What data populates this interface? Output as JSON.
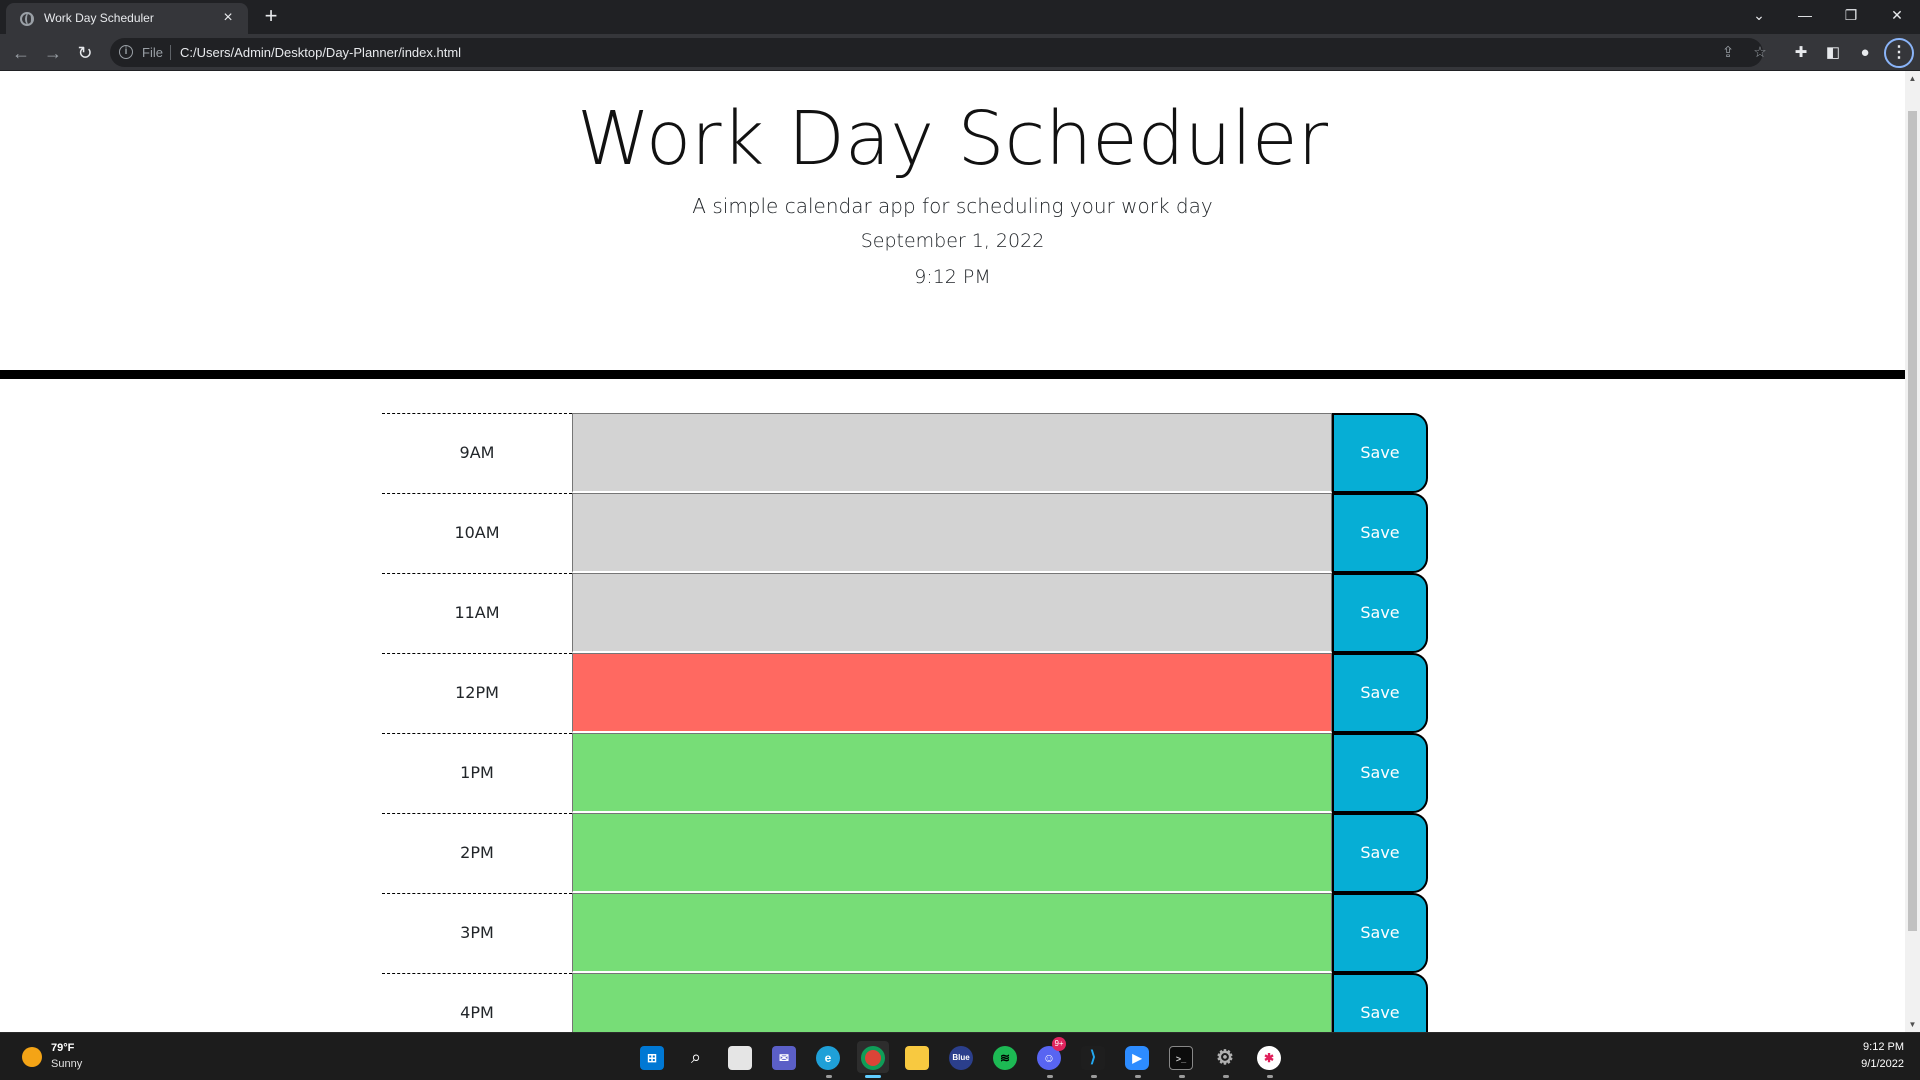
{
  "browser": {
    "tab_title": "Work Day Scheduler",
    "tab_close": "×",
    "new_tab": "+",
    "url_scheme_label": "File",
    "url": "C:/Users/Admin/Desktop/Day-Planner/index.html",
    "menu_glyph": "⋮"
  },
  "page": {
    "title": "Work Day Scheduler",
    "subtitle": "A simple calendar app for scheduling your work day",
    "current_date": "September 1, 2022",
    "current_time": "9:12 PM",
    "save_label": "Save",
    "rows": [
      {
        "hour": "9AM",
        "status": "past",
        "text": ""
      },
      {
        "hour": "10AM",
        "status": "past",
        "text": ""
      },
      {
        "hour": "11AM",
        "status": "past",
        "text": ""
      },
      {
        "hour": "12PM",
        "status": "present",
        "text": ""
      },
      {
        "hour": "1PM",
        "status": "future",
        "text": ""
      },
      {
        "hour": "2PM",
        "status": "future",
        "text": ""
      },
      {
        "hour": "3PM",
        "status": "future",
        "text": ""
      },
      {
        "hour": "4PM",
        "status": "future",
        "text": ""
      }
    ],
    "colors": {
      "past": "#d3d3d3",
      "present": "#ff6961",
      "future": "#77dd77",
      "save_button": "#06aed5"
    }
  },
  "taskbar": {
    "weather_temp": "79°F",
    "weather_condition": "Sunny",
    "clock_time": "9:12 PM",
    "clock_date": "9/1/2022",
    "discord_badge": "9+",
    "apps": [
      "start",
      "search",
      "task-view",
      "chat",
      "edge",
      "chrome",
      "file-explorer",
      "bluestacks",
      "spotify",
      "discord",
      "vscode",
      "zoom",
      "terminal",
      "settings",
      "slack"
    ]
  }
}
